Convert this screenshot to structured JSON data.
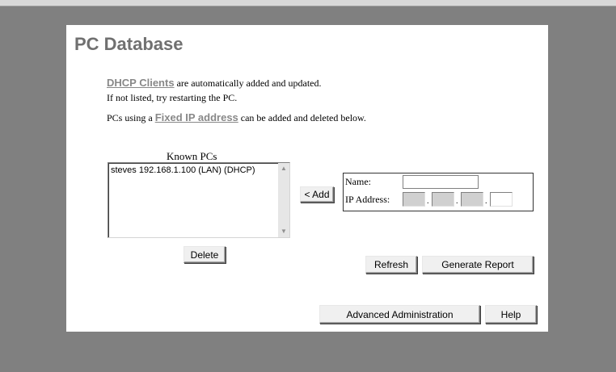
{
  "page": {
    "title": "PC Database",
    "dhcp_link": "DHCP Clients",
    "dhcp_text": " are automatically added and updated.",
    "not_listed_text": "If not listed, try restarting the PC.",
    "fixed_prefix": "PCs using a ",
    "fixed_link": "Fixed IP address",
    "fixed_suffix": " can be added and deleted below."
  },
  "known_pcs": {
    "label": "Known PCs",
    "items": [
      "steves 192.168.1.100 (LAN) (DHCP)"
    ]
  },
  "buttons": {
    "add": "< Add",
    "delete": "Delete",
    "refresh": "Refresh",
    "generate_report": "Generate Report",
    "advanced": "Advanced Administration",
    "help": "Help"
  },
  "form": {
    "name_label": "Name:",
    "ip_label": "IP Address:",
    "name_value": "",
    "ip_octets": [
      "",
      "",
      "",
      ""
    ]
  }
}
